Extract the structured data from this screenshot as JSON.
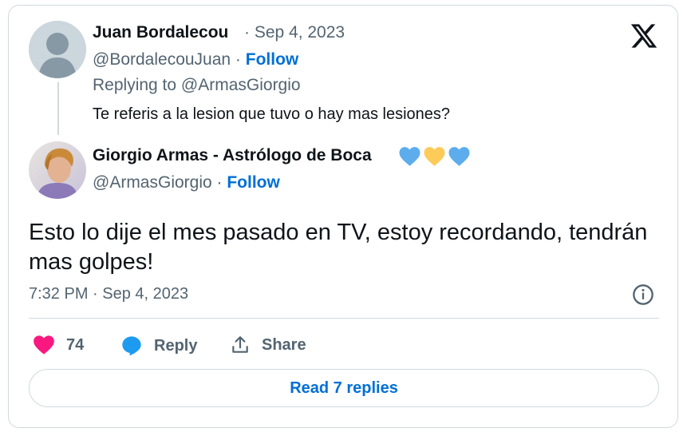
{
  "parent_tweet": {
    "author_name": "Juan Bordalecou",
    "date": "· Sep 4, 2023",
    "handle": "@BordalecouJuan ·",
    "follow_label": "Follow",
    "replying_to": "Replying to @ArmasGiorgio",
    "text": "Te referis a la lesion que tuvo o hay mas lesiones?"
  },
  "main_tweet": {
    "author_name": "Giorgio Armas - Astrólogo de Boca",
    "name_emojis": [
      "blue-heart-icon",
      "yellow-heart-icon",
      "blue-heart-icon"
    ],
    "handle": "@ArmasGiorgio ·",
    "follow_label": "Follow",
    "text": "Esto lo dije el mes pasado en TV, estoy recordando, tendrán mas golpes!",
    "timestamp": "7:32 PM · Sep 4, 2023"
  },
  "actions": {
    "like_count": "74",
    "reply_label": "Reply",
    "share_label": "Share"
  },
  "read_replies_label": "Read 7 replies",
  "colors": {
    "accent": "#006fd6",
    "like": "#f91880",
    "reply_bubble": "#1d9bf0",
    "muted_text": "#536471",
    "border": "#cfd9de",
    "blue_heart": "#5dadec",
    "yellow_heart": "#fdcb58"
  },
  "icons": {
    "logo": "x-logo-icon",
    "info": "info-icon",
    "like": "heart-icon",
    "reply": "speech-bubble-icon",
    "share": "share-icon"
  }
}
